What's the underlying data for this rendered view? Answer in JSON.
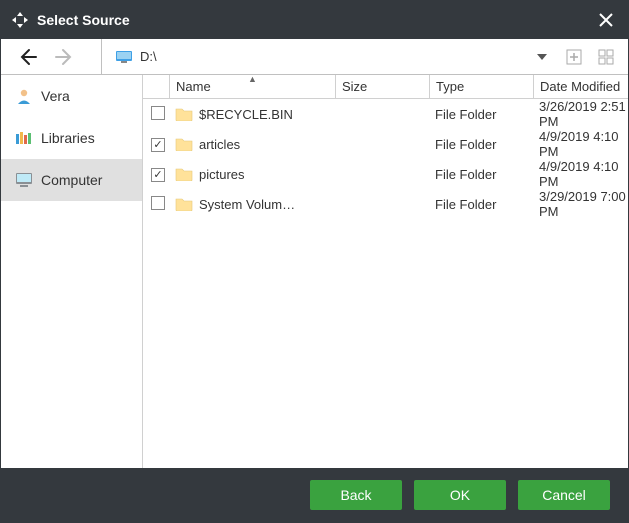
{
  "window": {
    "title": "Select Source"
  },
  "toolbar": {
    "path": "D:\\"
  },
  "sidebar": {
    "items": [
      {
        "label": "Vera",
        "icon": "user",
        "selected": false
      },
      {
        "label": "Libraries",
        "icon": "library",
        "selected": false
      },
      {
        "label": "Computer",
        "icon": "computer",
        "selected": true
      }
    ]
  },
  "columns": {
    "name": "Name",
    "size": "Size",
    "type": "Type",
    "date": "Date Modified"
  },
  "rows": [
    {
      "checked": false,
      "name": "$RECYCLE.BIN",
      "size": "",
      "type": "File Folder",
      "date": "3/26/2019 2:51 PM"
    },
    {
      "checked": true,
      "name": "articles",
      "size": "",
      "type": "File Folder",
      "date": "4/9/2019 4:10 PM"
    },
    {
      "checked": true,
      "name": "pictures",
      "size": "",
      "type": "File Folder",
      "date": "4/9/2019 4:10 PM"
    },
    {
      "checked": false,
      "name": "System Volum…",
      "size": "",
      "type": "File Folder",
      "date": "3/29/2019 7:00 PM"
    }
  ],
  "buttons": {
    "back": "Back",
    "ok": "OK",
    "cancel": "Cancel"
  }
}
